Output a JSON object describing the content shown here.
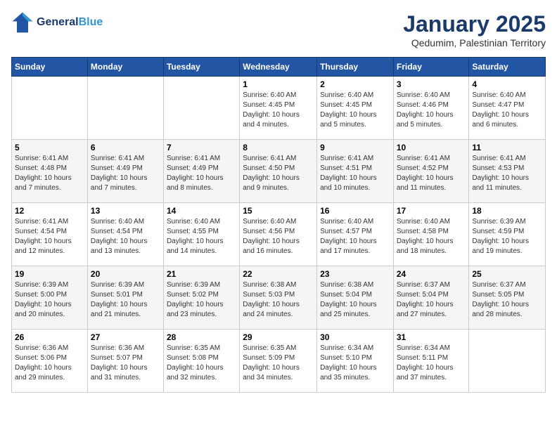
{
  "header": {
    "logo_line1": "General",
    "logo_line2": "Blue",
    "month_title": "January 2025",
    "subtitle": "Qedumim, Palestinian Territory"
  },
  "days_of_week": [
    "Sunday",
    "Monday",
    "Tuesday",
    "Wednesday",
    "Thursday",
    "Friday",
    "Saturday"
  ],
  "weeks": [
    [
      {
        "day": "",
        "info": ""
      },
      {
        "day": "",
        "info": ""
      },
      {
        "day": "",
        "info": ""
      },
      {
        "day": "1",
        "info": "Sunrise: 6:40 AM\nSunset: 4:45 PM\nDaylight: 10 hours\nand 4 minutes."
      },
      {
        "day": "2",
        "info": "Sunrise: 6:40 AM\nSunset: 4:45 PM\nDaylight: 10 hours\nand 5 minutes."
      },
      {
        "day": "3",
        "info": "Sunrise: 6:40 AM\nSunset: 4:46 PM\nDaylight: 10 hours\nand 5 minutes."
      },
      {
        "day": "4",
        "info": "Sunrise: 6:40 AM\nSunset: 4:47 PM\nDaylight: 10 hours\nand 6 minutes."
      }
    ],
    [
      {
        "day": "5",
        "info": "Sunrise: 6:41 AM\nSunset: 4:48 PM\nDaylight: 10 hours\nand 7 minutes."
      },
      {
        "day": "6",
        "info": "Sunrise: 6:41 AM\nSunset: 4:49 PM\nDaylight: 10 hours\nand 7 minutes."
      },
      {
        "day": "7",
        "info": "Sunrise: 6:41 AM\nSunset: 4:49 PM\nDaylight: 10 hours\nand 8 minutes."
      },
      {
        "day": "8",
        "info": "Sunrise: 6:41 AM\nSunset: 4:50 PM\nDaylight: 10 hours\nand 9 minutes."
      },
      {
        "day": "9",
        "info": "Sunrise: 6:41 AM\nSunset: 4:51 PM\nDaylight: 10 hours\nand 10 minutes."
      },
      {
        "day": "10",
        "info": "Sunrise: 6:41 AM\nSunset: 4:52 PM\nDaylight: 10 hours\nand 11 minutes."
      },
      {
        "day": "11",
        "info": "Sunrise: 6:41 AM\nSunset: 4:53 PM\nDaylight: 10 hours\nand 11 minutes."
      }
    ],
    [
      {
        "day": "12",
        "info": "Sunrise: 6:41 AM\nSunset: 4:54 PM\nDaylight: 10 hours\nand 12 minutes."
      },
      {
        "day": "13",
        "info": "Sunrise: 6:40 AM\nSunset: 4:54 PM\nDaylight: 10 hours\nand 13 minutes."
      },
      {
        "day": "14",
        "info": "Sunrise: 6:40 AM\nSunset: 4:55 PM\nDaylight: 10 hours\nand 14 minutes."
      },
      {
        "day": "15",
        "info": "Sunrise: 6:40 AM\nSunset: 4:56 PM\nDaylight: 10 hours\nand 16 minutes."
      },
      {
        "day": "16",
        "info": "Sunrise: 6:40 AM\nSunset: 4:57 PM\nDaylight: 10 hours\nand 17 minutes."
      },
      {
        "day": "17",
        "info": "Sunrise: 6:40 AM\nSunset: 4:58 PM\nDaylight: 10 hours\nand 18 minutes."
      },
      {
        "day": "18",
        "info": "Sunrise: 6:39 AM\nSunset: 4:59 PM\nDaylight: 10 hours\nand 19 minutes."
      }
    ],
    [
      {
        "day": "19",
        "info": "Sunrise: 6:39 AM\nSunset: 5:00 PM\nDaylight: 10 hours\nand 20 minutes."
      },
      {
        "day": "20",
        "info": "Sunrise: 6:39 AM\nSunset: 5:01 PM\nDaylight: 10 hours\nand 21 minutes."
      },
      {
        "day": "21",
        "info": "Sunrise: 6:39 AM\nSunset: 5:02 PM\nDaylight: 10 hours\nand 23 minutes."
      },
      {
        "day": "22",
        "info": "Sunrise: 6:38 AM\nSunset: 5:03 PM\nDaylight: 10 hours\nand 24 minutes."
      },
      {
        "day": "23",
        "info": "Sunrise: 6:38 AM\nSunset: 5:04 PM\nDaylight: 10 hours\nand 25 minutes."
      },
      {
        "day": "24",
        "info": "Sunrise: 6:37 AM\nSunset: 5:04 PM\nDaylight: 10 hours\nand 27 minutes."
      },
      {
        "day": "25",
        "info": "Sunrise: 6:37 AM\nSunset: 5:05 PM\nDaylight: 10 hours\nand 28 minutes."
      }
    ],
    [
      {
        "day": "26",
        "info": "Sunrise: 6:36 AM\nSunset: 5:06 PM\nDaylight: 10 hours\nand 29 minutes."
      },
      {
        "day": "27",
        "info": "Sunrise: 6:36 AM\nSunset: 5:07 PM\nDaylight: 10 hours\nand 31 minutes."
      },
      {
        "day": "28",
        "info": "Sunrise: 6:35 AM\nSunset: 5:08 PM\nDaylight: 10 hours\nand 32 minutes."
      },
      {
        "day": "29",
        "info": "Sunrise: 6:35 AM\nSunset: 5:09 PM\nDaylight: 10 hours\nand 34 minutes."
      },
      {
        "day": "30",
        "info": "Sunrise: 6:34 AM\nSunset: 5:10 PM\nDaylight: 10 hours\nand 35 minutes."
      },
      {
        "day": "31",
        "info": "Sunrise: 6:34 AM\nSunset: 5:11 PM\nDaylight: 10 hours\nand 37 minutes."
      },
      {
        "day": "",
        "info": ""
      }
    ]
  ]
}
